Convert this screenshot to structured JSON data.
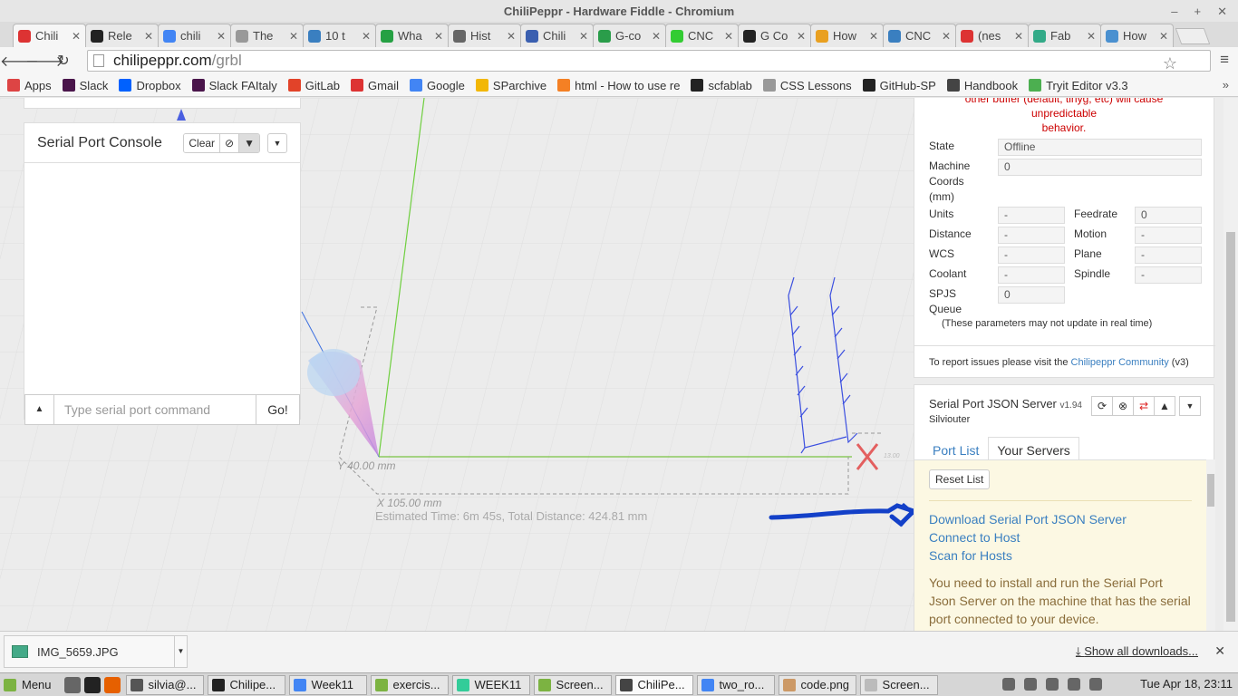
{
  "window": {
    "title": "ChiliPeppr - Hardware Fiddle - Chromium"
  },
  "tabs": [
    {
      "label": "Chili",
      "icon": "chilipeppr-icon",
      "color": "#d33"
    },
    {
      "label": "Rele",
      "icon": "github-icon",
      "color": "#222"
    },
    {
      "label": "chili",
      "icon": "google-icon",
      "color": "#4285f4"
    },
    {
      "label": "The",
      "icon": "page-icon",
      "color": "#999"
    },
    {
      "label": "10 t",
      "icon": "page-icon",
      "color": "#3a7fc0"
    },
    {
      "label": "Wha",
      "icon": "whatsapp-icon",
      "color": "#25a043"
    },
    {
      "label": "Hist",
      "icon": "history-icon",
      "color": "#666"
    },
    {
      "label": "Chili",
      "icon": "chilipeppr-icon",
      "color": "#3a5fb0"
    },
    {
      "label": "G-co",
      "icon": "leaf-icon",
      "color": "#2a9d4a"
    },
    {
      "label": "CNC",
      "icon": "u-icon",
      "color": "#3c3"
    },
    {
      "label": "G Co",
      "icon": "diy-icon",
      "color": "#222"
    },
    {
      "label": "How",
      "icon": "person-icon",
      "color": "#e9a020"
    },
    {
      "label": "CNC",
      "icon": "cnc-icon",
      "color": "#3a7fc0"
    },
    {
      "label": "(nes",
      "icon": "gmail-icon",
      "color": "#d33"
    },
    {
      "label": "Fab",
      "icon": "fab-icon",
      "color": "#3a8"
    },
    {
      "label": "How",
      "icon": "3d-icon",
      "color": "#4a90d0"
    }
  ],
  "address": {
    "host": "chilipeppr.com",
    "path": "/grbl"
  },
  "bookmarks": [
    {
      "label": "Apps",
      "color": "#d44"
    },
    {
      "label": "Slack",
      "color": "#4a154b"
    },
    {
      "label": "Dropbox",
      "color": "#0061fe"
    },
    {
      "label": "Slack FAItaly",
      "color": "#4a154b"
    },
    {
      "label": "GitLab",
      "color": "#e24329"
    },
    {
      "label": "Gmail",
      "color": "#d33"
    },
    {
      "label": "Google",
      "color": "#4285f4"
    },
    {
      "label": "SParchive",
      "color": "#f2b705"
    },
    {
      "label": "html - How to use re",
      "color": "#f48024"
    },
    {
      "label": "scfablab",
      "color": "#222"
    },
    {
      "label": "CSS Lessons",
      "color": "#999"
    },
    {
      "label": "GitHub-SP",
      "color": "#222"
    },
    {
      "label": "Handbook",
      "color": "#444"
    },
    {
      "label": "Tryit Editor v3.3",
      "color": "#4caf50"
    }
  ],
  "console": {
    "title": "Serial Port Console",
    "clear": "Clear",
    "placeholder": "Type serial port command",
    "go": "Go!"
  },
  "scene": {
    "y_label": "Y 40.00 mm",
    "x_label": "X 105.00 mm",
    "estimate": "Estimated Time: 6m 45s, Total Distance: 424.81 mm",
    "small_label": "13.00"
  },
  "grbl": {
    "warning_line1": "other buffer (default, tinyg, etc) will cause unpredictable",
    "warning_line2": "behavior.",
    "state_label": "State",
    "state": "Offline",
    "coords_label_1": "Machine",
    "coords_label_2": "Coords",
    "coords_label_3": "(mm)",
    "coords": "0",
    "units_label": "Units",
    "units": "-",
    "feedrate_label": "Feedrate",
    "feedrate": "0",
    "distance_label": "Distance",
    "distance": "-",
    "motion_label": "Motion",
    "motion": "-",
    "wcs_label": "WCS",
    "wcs": "-",
    "plane_label": "Plane",
    "plane": "-",
    "coolant_label": "Coolant",
    "coolant": "-",
    "spindle_label": "Spindle",
    "spindle": "-",
    "queue_label_1": "SPJS",
    "queue_label_2": "Queue",
    "queue": "0",
    "note": "(These parameters may not update in real time)",
    "report_pre": "To report issues please visit the ",
    "report_link": "Chilipeppr Community",
    "report_post": " (v3)"
  },
  "spjs": {
    "title": "Serial Port JSON Server",
    "version": "v1.94",
    "subtitle": "Silviouter",
    "tab_ports": "Port List",
    "tab_servers": "Your Servers",
    "reset": "Reset List",
    "link_download": "Download Serial Port JSON Server",
    "link_connect": "Connect to Host",
    "link_scan": "Scan for Hosts",
    "message": "You need to install and run the Serial Port Json Server on the machine that has the serial port connected to your device."
  },
  "downloads": {
    "file": "IMG_5659.JPG",
    "show_all": "Show all downloads..."
  },
  "taskbar": {
    "menu": "Menu",
    "items": [
      "silvia@...",
      "Chilipe...",
      "Week11",
      "exercis...",
      "WEEK11",
      "Screen...",
      "ChiliPe...",
      "two_ro...",
      "code.png",
      "Screen..."
    ],
    "clock": "Tue Apr 18, 23:11"
  },
  "colors": {
    "accent_link": "#3a7fc0",
    "warning": "#cc0000",
    "alert_bg": "#fcf8e3",
    "x_axis": "#7ac143",
    "y_axis": "#6fcf3f",
    "toolpath": "#3b4fe0",
    "annotation_arrow": "#1340c8"
  }
}
